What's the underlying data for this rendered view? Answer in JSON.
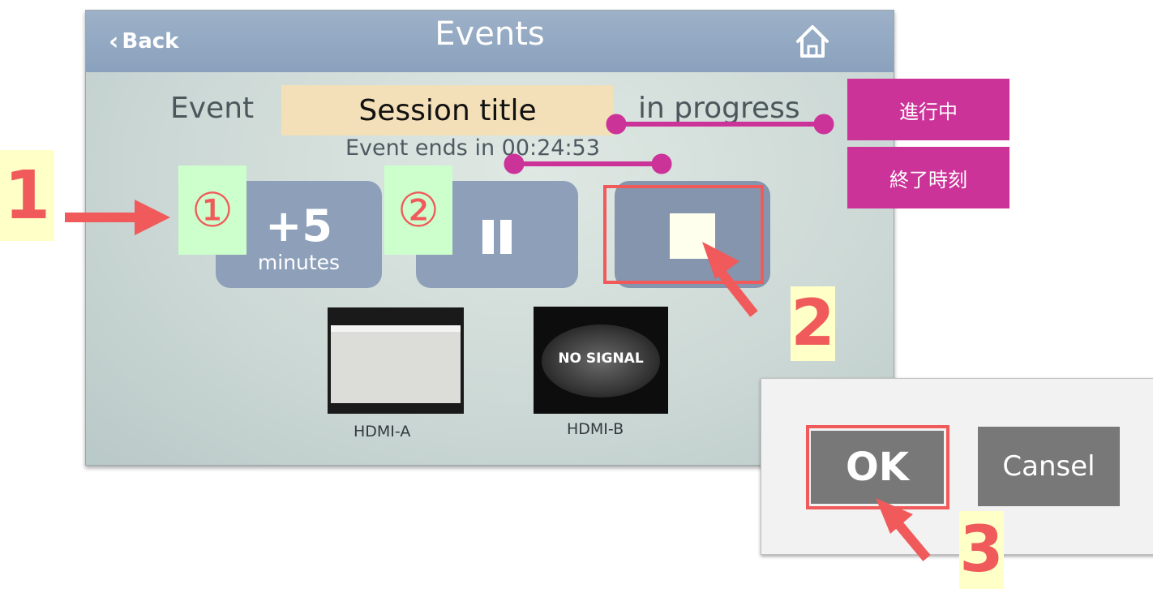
{
  "header": {
    "back_label": "Back",
    "title": "Events",
    "home_icon": "home-icon"
  },
  "status": {
    "event_word": "Event",
    "in_progress": "in progress",
    "ends_text": "Event ends in 00:24:53"
  },
  "controls": {
    "plus5_big": "+5",
    "plus5_small": "minutes",
    "pause_icon": "pause-icon",
    "stop_icon": "stop-icon"
  },
  "sources": {
    "hdmi_a_label": "HDMI-A",
    "hdmi_b_label": "HDMI-B",
    "hdmi_b_overlay": "NO SIGNAL"
  },
  "annotations": {
    "session_title": "Session title",
    "tag_progress": "進行中",
    "tag_endtime": "終了時刻",
    "step1": "1",
    "step2": "2",
    "step3": "3",
    "circ1": "①",
    "circ2": "②"
  },
  "dialog": {
    "ok_label": "OK",
    "cancel_label": "Cansel"
  },
  "colors": {
    "header": "#8aa1bd",
    "button": "#8ea0b9",
    "annotation_red": "#f05a5a",
    "annotation_pink": "#cc3399",
    "dialog_button": "#787878"
  }
}
